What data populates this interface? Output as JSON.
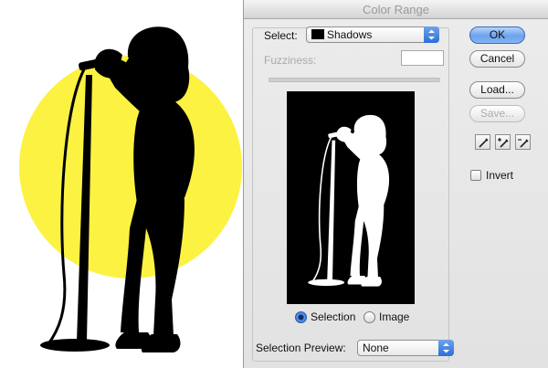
{
  "dialog": {
    "title": "Color Range",
    "select": {
      "label": "Select:",
      "value": "Shadows"
    },
    "fuzziness": {
      "label": "Fuzziness:",
      "value": ""
    },
    "preview_mode": {
      "options": [
        {
          "label": "Selection",
          "selected": true
        },
        {
          "label": "Image",
          "selected": false
        }
      ]
    },
    "selection_preview": {
      "label": "Selection Preview:",
      "value": "None"
    },
    "buttons": {
      "ok": "OK",
      "cancel": "Cancel",
      "load": "Load...",
      "save": "Save..."
    },
    "eyedroppers": [
      "eyedropper-icon",
      "eyedropper-plus-icon",
      "eyedropper-minus-icon"
    ],
    "invert": {
      "label": "Invert",
      "checked": false
    }
  },
  "colors": {
    "sun": "#fcf242",
    "silhouette": "#000000",
    "accent": "#3a7de0"
  }
}
